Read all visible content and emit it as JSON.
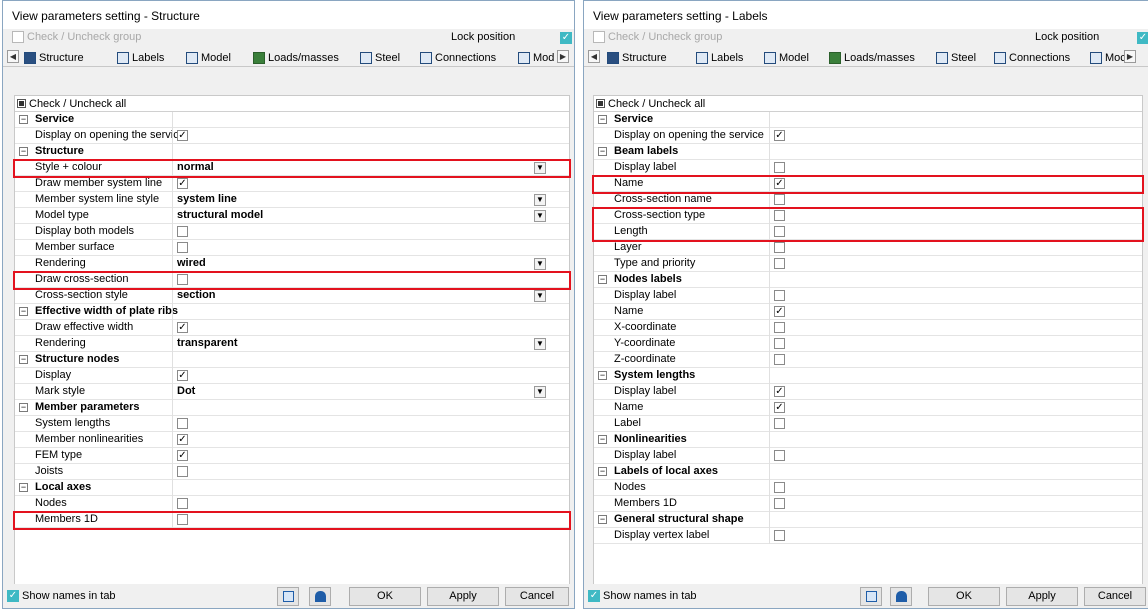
{
  "left": {
    "title": "View parameters setting - Structure",
    "check_group": "Check / Uncheck group",
    "lock_position": "Lock position",
    "tabs": [
      "Structure",
      "Labels",
      "Model",
      "Loads/masses",
      "Steel",
      "Connections",
      "Mod"
    ],
    "check_all": "Check / Uncheck all",
    "rows": [
      {
        "label": "Service",
        "group": true
      },
      {
        "label": "Display on opening the service",
        "check": true
      },
      {
        "label": "Structure",
        "group": true
      },
      {
        "label": "Style + colour",
        "value": "normal",
        "dropdown": true
      },
      {
        "label": "Draw member system line",
        "check": true
      },
      {
        "label": "Member system line style",
        "value": "system line",
        "dropdown": true
      },
      {
        "label": "Model type",
        "value": "structural model",
        "dropdown": true
      },
      {
        "label": "Display both models",
        "check": false
      },
      {
        "label": "Member surface",
        "check": false
      },
      {
        "label": "Rendering",
        "value": "wired",
        "dropdown": true
      },
      {
        "label": "Draw cross-section",
        "check": false
      },
      {
        "label": "Cross-section style",
        "value": "section",
        "dropdown": true
      },
      {
        "label": "Effective width of plate ribs",
        "group": true
      },
      {
        "label": "Draw effective width",
        "check": true
      },
      {
        "label": "Rendering",
        "value": "transparent",
        "dropdown": true
      },
      {
        "label": "Structure nodes",
        "group": true
      },
      {
        "label": "Display",
        "check": true
      },
      {
        "label": "Mark style",
        "value": "Dot",
        "dropdown": true
      },
      {
        "label": "Member parameters",
        "group": true
      },
      {
        "label": "System lengths",
        "check": false
      },
      {
        "label": "Member nonlinearities",
        "check": true
      },
      {
        "label": "FEM type",
        "check": true
      },
      {
        "label": "Joists",
        "check": false
      },
      {
        "label": "Local axes",
        "group": true
      },
      {
        "label": "Nodes",
        "check": false
      },
      {
        "label": "Members 1D",
        "check": false
      }
    ],
    "footer": {
      "show_names": "Show names in tab",
      "ok": "OK",
      "apply": "Apply",
      "cancel": "Cancel"
    }
  },
  "right": {
    "title": "View parameters setting - Labels",
    "check_group": "Check / Uncheck group",
    "lock_position": "Lock position",
    "tabs": [
      "Structure",
      "Labels",
      "Model",
      "Loads/masses",
      "Steel",
      "Connections",
      "Moc"
    ],
    "check_all": "Check / Uncheck all",
    "rows": [
      {
        "label": "Service",
        "group": true
      },
      {
        "label": "Display on opening the service",
        "check": true
      },
      {
        "label": "Beam labels",
        "group": true
      },
      {
        "label": "Display label",
        "check": false
      },
      {
        "label": "Name",
        "check": true
      },
      {
        "label": "Cross-section name",
        "check": false
      },
      {
        "label": "Cross-section type",
        "check": false
      },
      {
        "label": "Length",
        "check": false
      },
      {
        "label": "Layer",
        "check": false
      },
      {
        "label": "Type and priority",
        "check": false
      },
      {
        "label": "Nodes labels",
        "group": true
      },
      {
        "label": "Display label",
        "check": false
      },
      {
        "label": "Name",
        "check": true
      },
      {
        "label": "X-coordinate",
        "check": false
      },
      {
        "label": "Y-coordinate",
        "check": false
      },
      {
        "label": "Z-coordinate",
        "check": false
      },
      {
        "label": "System lengths",
        "group": true
      },
      {
        "label": "Display label",
        "check": true
      },
      {
        "label": "Name",
        "check": true
      },
      {
        "label": "Label",
        "check": false
      },
      {
        "label": "Nonlinearities",
        "group": true
      },
      {
        "label": "Display label",
        "check": false
      },
      {
        "label": "Labels of local axes",
        "group": true
      },
      {
        "label": "Nodes",
        "check": false
      },
      {
        "label": "Members 1D",
        "check": false
      },
      {
        "label": "General structural shape",
        "group": true
      },
      {
        "label": "Display vertex label",
        "check": false
      }
    ],
    "footer": {
      "show_names": "Show names in tab",
      "ok": "OK",
      "apply": "Apply",
      "cancel": "Cancel"
    }
  },
  "colors": {
    "highlight": "#e3121e",
    "accent": "#3fb9c4"
  },
  "icons": [
    "structure-icon",
    "labels-icon",
    "model-icon",
    "loads-icon",
    "steel-icon",
    "connections-icon",
    "tab-scroll-arrow-icon",
    "expander-icon",
    "checkbox-icon",
    "dropdown-arrow-icon",
    "save-icon",
    "load-icon"
  ]
}
